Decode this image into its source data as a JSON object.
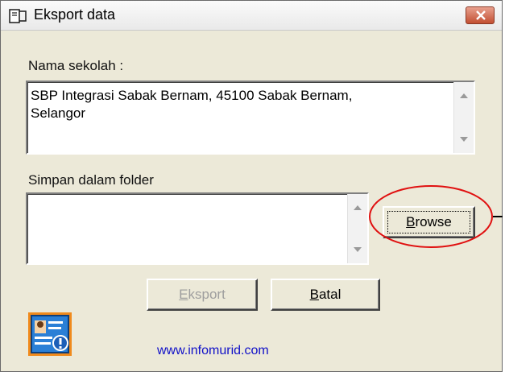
{
  "window": {
    "title": "Eksport data"
  },
  "school": {
    "label": "Nama sekolah :",
    "value_line1": "SBP Integrasi Sabak Bernam, 45100 Sabak Bernam,",
    "value_line2": "Selangor"
  },
  "folder": {
    "label": "Simpan dalam folder",
    "value": ""
  },
  "buttons": {
    "browse_prefix": "B",
    "browse_rest": "rowse",
    "eksport_prefix": "E",
    "eksport_rest": "ksport",
    "batal_prefix": "B",
    "batal_rest": "atal"
  },
  "footer": {
    "link": "www.infomurid.com"
  },
  "colors": {
    "title_close": "#c24f32",
    "annotation_ellipse": "#e01010",
    "link": "#1010c8",
    "icon_bg": "#f08a1c",
    "icon_panel": "#2a7fd6"
  },
  "icons": [
    "app-icon",
    "close-icon",
    "info-card-icon"
  ]
}
